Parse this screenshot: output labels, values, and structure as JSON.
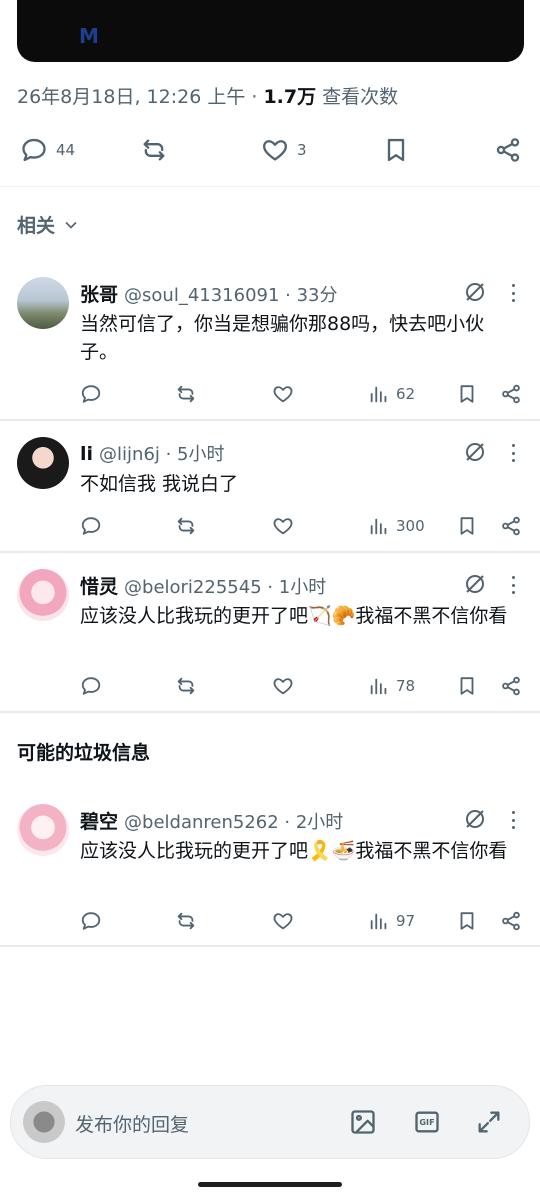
{
  "media": {
    "logo": "M"
  },
  "post_meta": {
    "timestamp": "26年8月18日, 12:26 上午",
    "separator": " · ",
    "views_count": "1.7万",
    "views_label": " 查看次数"
  },
  "post_actions": {
    "reply_count": "44",
    "like_count": "3"
  },
  "related": {
    "label": "相关"
  },
  "replies": [
    {
      "name": "张哥",
      "handle": "@soul_41316091 · 33分",
      "text": "当然可信了，你当是想骗你那88吗，快去吧小伙子。",
      "views": "62"
    },
    {
      "name": "li",
      "handle": "@lijn6j · 5小时",
      "text": "不如信我 我说白了",
      "views": "300"
    },
    {
      "name": "惜灵",
      "handle": "@belori225545 · 1小时",
      "text": "应该没人比我玩的更开了吧🏹🥐我福不黑不信你看",
      "views": "78"
    }
  ],
  "spam_section": {
    "title": "可能的垃圾信息"
  },
  "spam_replies": [
    {
      "name": "碧空",
      "handle": "@beldanren5262 · 2小时",
      "text": "应该没人比我玩的更开了吧🎗️🍜我福不黑不信你看",
      "views": "97"
    }
  ],
  "compose": {
    "placeholder": "发布你的回复"
  },
  "icons": {
    "reply": "reply-icon",
    "retweet": "retweet-icon",
    "like": "heart-icon",
    "bookmark": "bookmark-icon",
    "share": "share-icon",
    "views": "views-icon",
    "grok": "grok-icon",
    "more": "more-icon",
    "image": "image-icon",
    "gif": "gif-icon",
    "expand": "expand-icon"
  }
}
